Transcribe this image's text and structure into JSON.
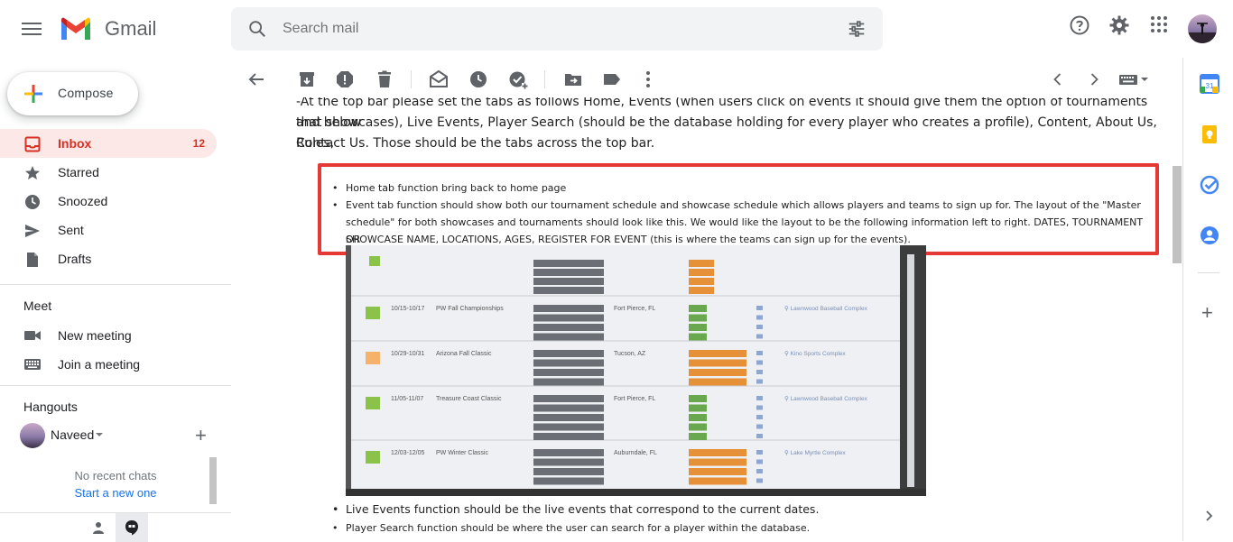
{
  "app": {
    "name": "Gmail",
    "search_placeholder": "Search mail"
  },
  "compose": {
    "label": "Compose"
  },
  "nav": [
    {
      "label": "Inbox",
      "count": "12",
      "icon": "inbox-icon"
    },
    {
      "label": "Starred",
      "icon": "star-icon"
    },
    {
      "label": "Snoozed",
      "icon": "clock-icon"
    },
    {
      "label": "Sent",
      "icon": "send-icon"
    },
    {
      "label": "Drafts",
      "icon": "draft-icon"
    }
  ],
  "meet": {
    "title": "Meet",
    "new_meeting": "New meeting",
    "join_meeting": "Join a meeting"
  },
  "hangouts": {
    "title": "Hangouts",
    "user": "Naveed",
    "no_chats": "No recent chats",
    "start_chat": "Start a new one"
  },
  "email": {
    "intro_line1": "-At the top bar please set the tabs as follows Home, Events (when users click on events it should give them the option of tournaments and below",
    "intro_line2": "that showcases), Live Events, Player Search (should be the database holding for every player who creates a profile), Content, About Us, Rules,",
    "intro_line3": "Contact Us. Those should be the tabs across the top bar.",
    "bullet1": "Home tab function bring back to home page",
    "bullet2_line1": "Event tab function should show both our tournament schedule and showcase schedule which allows players and teams to sign up for. The layout of the \"Master",
    "bullet2_line2": "schedule\"  for both showcases and tournaments should look like this. We would like the layout to be the following information left to right. DATES, TOURNAMENT OR",
    "bullet2_line3": "SHOWCASE NAME, LOCATIONS, AGES, REGISTER FOR EVENT (this is where the teams can sign up for the events).",
    "bullet3": "Live Events function should be the live events that correspond to the current dates.",
    "bullet4": "Player Search function should be where the user can search for a player within the database."
  },
  "photo_rows": [
    {
      "state": "FL",
      "dates": "10/15-10/17",
      "name": "PW Fall Championships",
      "city": "Fort Pierce, FL",
      "ages": [
        "2026 Grad or 14U",
        "2025 Grad or 15U",
        "2024 Grad or 16U",
        "2022 2023 Grad or 18U 17U"
      ],
      "status": [
        "Open",
        "Open",
        "Open",
        "Open"
      ],
      "venue": "Lawnwood Baseball Complex"
    },
    {
      "state": "AZ",
      "dates": "10/29-10/31",
      "name": "Arizona Fall Classic",
      "city": "Tucson, AZ",
      "ages": [
        "2026 Grad or 14U",
        "2025 Grad or 15U",
        "2024 Grad or 16U",
        "2022 2023 Grad or 18U 17U"
      ],
      "status": [
        "Waiting List Available",
        "1 Team on Waiting List",
        "1 Spot Available",
        "3 Spots Available"
      ],
      "venue": "Kino Sports Complex"
    },
    {
      "state": "FL",
      "dates": "11/05-11/07",
      "name": "Treasure Coast Classic",
      "city": "Fort Pierce, FL",
      "ages": [
        "2027 Grad or 13U",
        "2026 Grad or 14U",
        "2025 Grad or 15U",
        "2024 Grad or 16U",
        "2022 2023 Grad or 18U 17U"
      ],
      "status": [
        "Open",
        "Open",
        "Open",
        "Open",
        "Open"
      ],
      "venue": "Lawnwood Baseball Complex"
    },
    {
      "state": "FL",
      "dates": "12/03-12/05",
      "name": "PW Winter Classic",
      "city": "Auburndale, FL",
      "ages": [
        "2027 Grad or 13U",
        "2026 Grad or 14U",
        "2025 Grad or 15U",
        "2024 Grad or 16U"
      ],
      "status": [
        "Waiting List Available",
        "Waiting List Available",
        "Waiting List Available",
        "Waiting List Available"
      ],
      "venue": "Lake Myrtle Complex"
    }
  ],
  "photo_top": {
    "state": "FL",
    "ages": [
      "2026 Grad or 14U",
      "2025 Grad or 15U",
      "2024 Grad or 16U",
      "2022 2023 Grad or 18U 17U"
    ],
    "status": [
      "CLOSED",
      "CLOSED",
      "CLOSED",
      "CLOSED"
    ]
  },
  "colors": {
    "accent_red": "#d93025",
    "highlight_border": "#e53935",
    "link_blue": "#1a73e8",
    "open_green": "#6aa84f",
    "waiting_orange": "#e69138",
    "closed_orange": "#e69138"
  }
}
